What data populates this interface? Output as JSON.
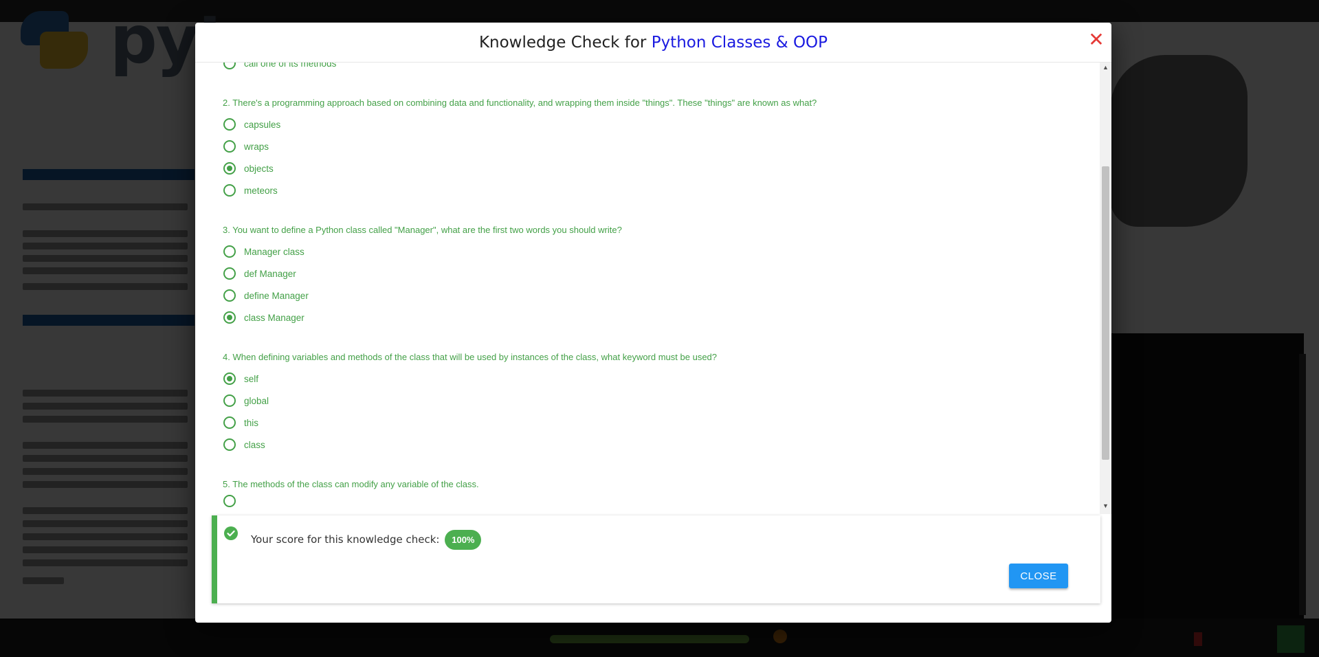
{
  "modal": {
    "title_prefix": "Knowledge Check for",
    "title_topic": "Python Classes & OOP",
    "close_icon": "close-icon",
    "colors": {
      "accent": "#43a047",
      "topic": "#1a1ae0",
      "close": "#e53935",
      "button": "#2196f3"
    }
  },
  "quiz": {
    "partial_option_above": "call one of its methods",
    "questions": [
      {
        "text": "2. There's a programming approach based on combining data and functionality, and wrapping them inside \"things\". These \"things\" are known as what?",
        "options": [
          {
            "label": "capsules",
            "selected": false
          },
          {
            "label": "wraps",
            "selected": false
          },
          {
            "label": "objects",
            "selected": true
          },
          {
            "label": "meteors",
            "selected": false
          }
        ]
      },
      {
        "text": "3. You want to define a Python class called \"Manager\", what are the first two words you should write?",
        "options": [
          {
            "label": "Manager class",
            "selected": false
          },
          {
            "label": "def Manager",
            "selected": false
          },
          {
            "label": "define Manager",
            "selected": false
          },
          {
            "label": "class Manager",
            "selected": true
          }
        ]
      },
      {
        "text": "4. When defining variables and methods of the class that will be used by instances of the class, what keyword must be used?",
        "options": [
          {
            "label": "self",
            "selected": true
          },
          {
            "label": "global",
            "selected": false
          },
          {
            "label": "this",
            "selected": false
          },
          {
            "label": "class",
            "selected": false
          }
        ]
      },
      {
        "text": "5. The methods of the class can modify any variable of the class.",
        "options": []
      }
    ]
  },
  "score": {
    "label": "Your score for this knowledge check:",
    "value": "100%",
    "check_icon": "check-circle-icon",
    "close_label": "CLOSE"
  },
  "background": {
    "logo_text": "pyt"
  }
}
